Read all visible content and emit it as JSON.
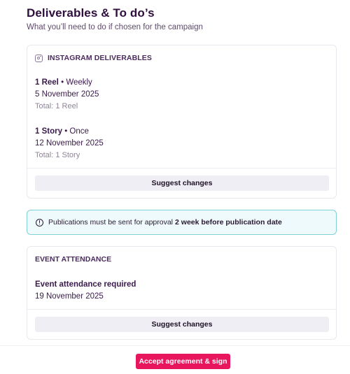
{
  "header": {
    "title": "Deliverables & To do’s",
    "subtitle": "What you’ll need to do if chosen for the campaign"
  },
  "instagram": {
    "heading": "INSTAGRAM DELIVERABLES",
    "icon": "instagram-icon",
    "items": [
      {
        "qty": "1 Reel",
        "separator": " • ",
        "frequency": "Weekly",
        "date": "5 November 2025",
        "total": "Total: 1 Reel"
      },
      {
        "qty": "1 Story",
        "separator": " • ",
        "frequency": "Once",
        "date": "12 November 2025",
        "total": "Total: 1 Story"
      }
    ],
    "suggest_label": "Suggest changes"
  },
  "notice": {
    "icon": "info-icon",
    "text": "Publications must be sent for approval",
    "emphasis": "2 week before publication date",
    "border_color": "#7fd3d8"
  },
  "event": {
    "heading": "EVENT ATTENDANCE",
    "title": "Event attendance required",
    "date": "19 November 2025",
    "suggest_label": "Suggest changes"
  },
  "footer": {
    "accept_label": "Accept agreement & sign",
    "accent_color": "#e8175d"
  }
}
